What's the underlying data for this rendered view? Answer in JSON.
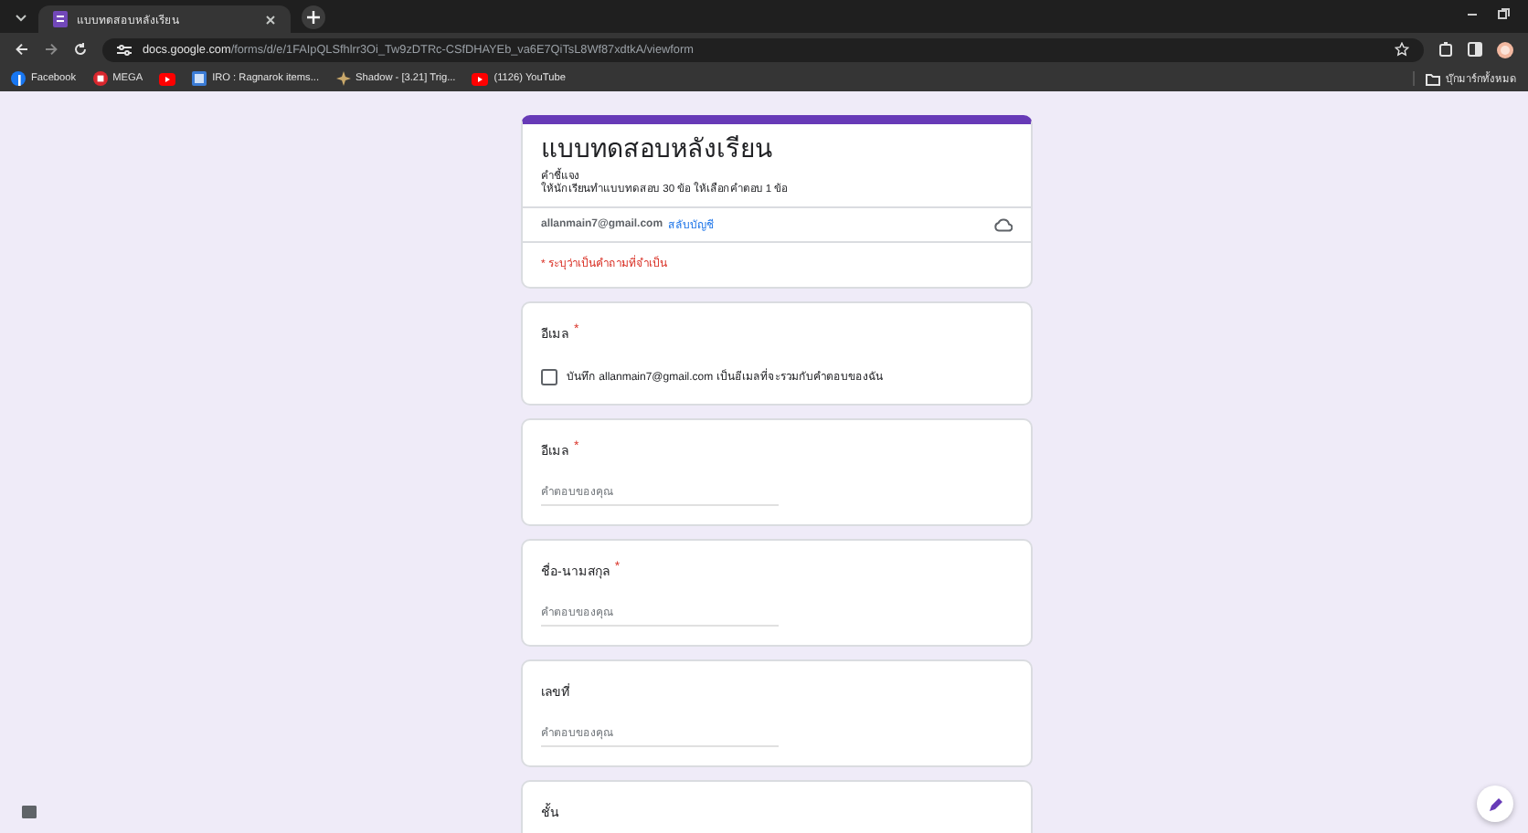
{
  "browser": {
    "tab_title": "แบบทดสอบหลังเรียน",
    "url_host": "docs.google.com",
    "url_path": "/forms/d/e/1FAIpQLSfhlrr3Oi_Tw9zDTRc-CSfDHAYEb_va6E7QiTsL8Wf87xdtkA/viewform",
    "bookmarks": [
      {
        "kind": "facebook",
        "label": "Facebook"
      },
      {
        "kind": "mega",
        "label": "MEGA"
      },
      {
        "kind": "youtube"
      },
      {
        "kind": "site",
        "label": "IRO : Ragnarok items..."
      },
      {
        "kind": "star",
        "label": "Shadow - [3.21] Trig..."
      },
      {
        "kind": "youtube",
        "label": "(1126) YouTube"
      }
    ],
    "all_bookmarks": "บุ๊กมาร์กทั้งหมด"
  },
  "form": {
    "title": "แบบทดสอบหลังเรียน",
    "description": [
      "คำชี้แจง",
      "ให้นักเรียนทำแบบทดสอบ 30 ข้อ ให้เลือกคำตอบ 1 ข้อ"
    ],
    "account_email": "allanmain7@gmail.com",
    "switch_account": "สลับบัญชี",
    "required_note": "* ระบุว่าเป็นคำถามที่จำเป็น",
    "required_mark": "*",
    "questions": [
      {
        "kind": "checkbox",
        "title": "อีเมล",
        "required": true,
        "option": "บันทึก allanmain7@gmail.com เป็นอีเมลที่จะรวมกับคำตอบของฉัน",
        "checked": false
      },
      {
        "kind": "text",
        "title": "อีเมล",
        "required": true,
        "placeholder": "คำตอบของคุณ"
      },
      {
        "kind": "text",
        "title": "ชื่อ-นามสกุล",
        "required": true,
        "placeholder": "คำตอบของคุณ"
      },
      {
        "kind": "text",
        "title": "เลขที่",
        "required": false,
        "placeholder": "คำตอบของคุณ"
      },
      {
        "kind": "text",
        "title": "ชั้น",
        "required": false
      }
    ]
  }
}
